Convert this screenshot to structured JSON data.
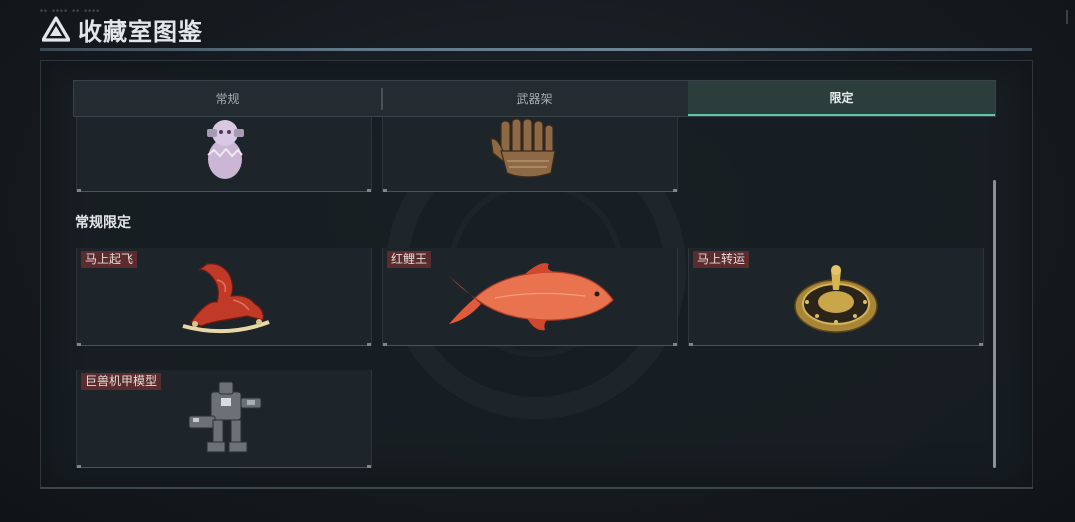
{
  "header": {
    "title": "收藏室图鉴",
    "logo": "delta-triangle-icon"
  },
  "tabs": [
    {
      "label": "常规",
      "active": false
    },
    {
      "label": "武器架",
      "active": false
    },
    {
      "label": "限定",
      "active": true
    }
  ],
  "colors": {
    "accent": "#5fc6a6",
    "name_tag_bg": "#5a2c2e",
    "panel_bg": "#1e252a"
  },
  "top_row_items": [
    {
      "icon": "egg-figurine-icon"
    },
    {
      "icon": "wooden-hand-sculpture-icon"
    }
  ],
  "section": {
    "title": "常规限定",
    "items": [
      {
        "name": "马上起飞",
        "icon": "red-horse-statue-icon"
      },
      {
        "name": "红鲤王",
        "icon": "red-carp-fish-icon"
      },
      {
        "name": "马上转运",
        "icon": "golden-compass-disc-icon"
      },
      {
        "name": "巨兽机甲模型",
        "icon": "mech-model-icon"
      }
    ]
  }
}
